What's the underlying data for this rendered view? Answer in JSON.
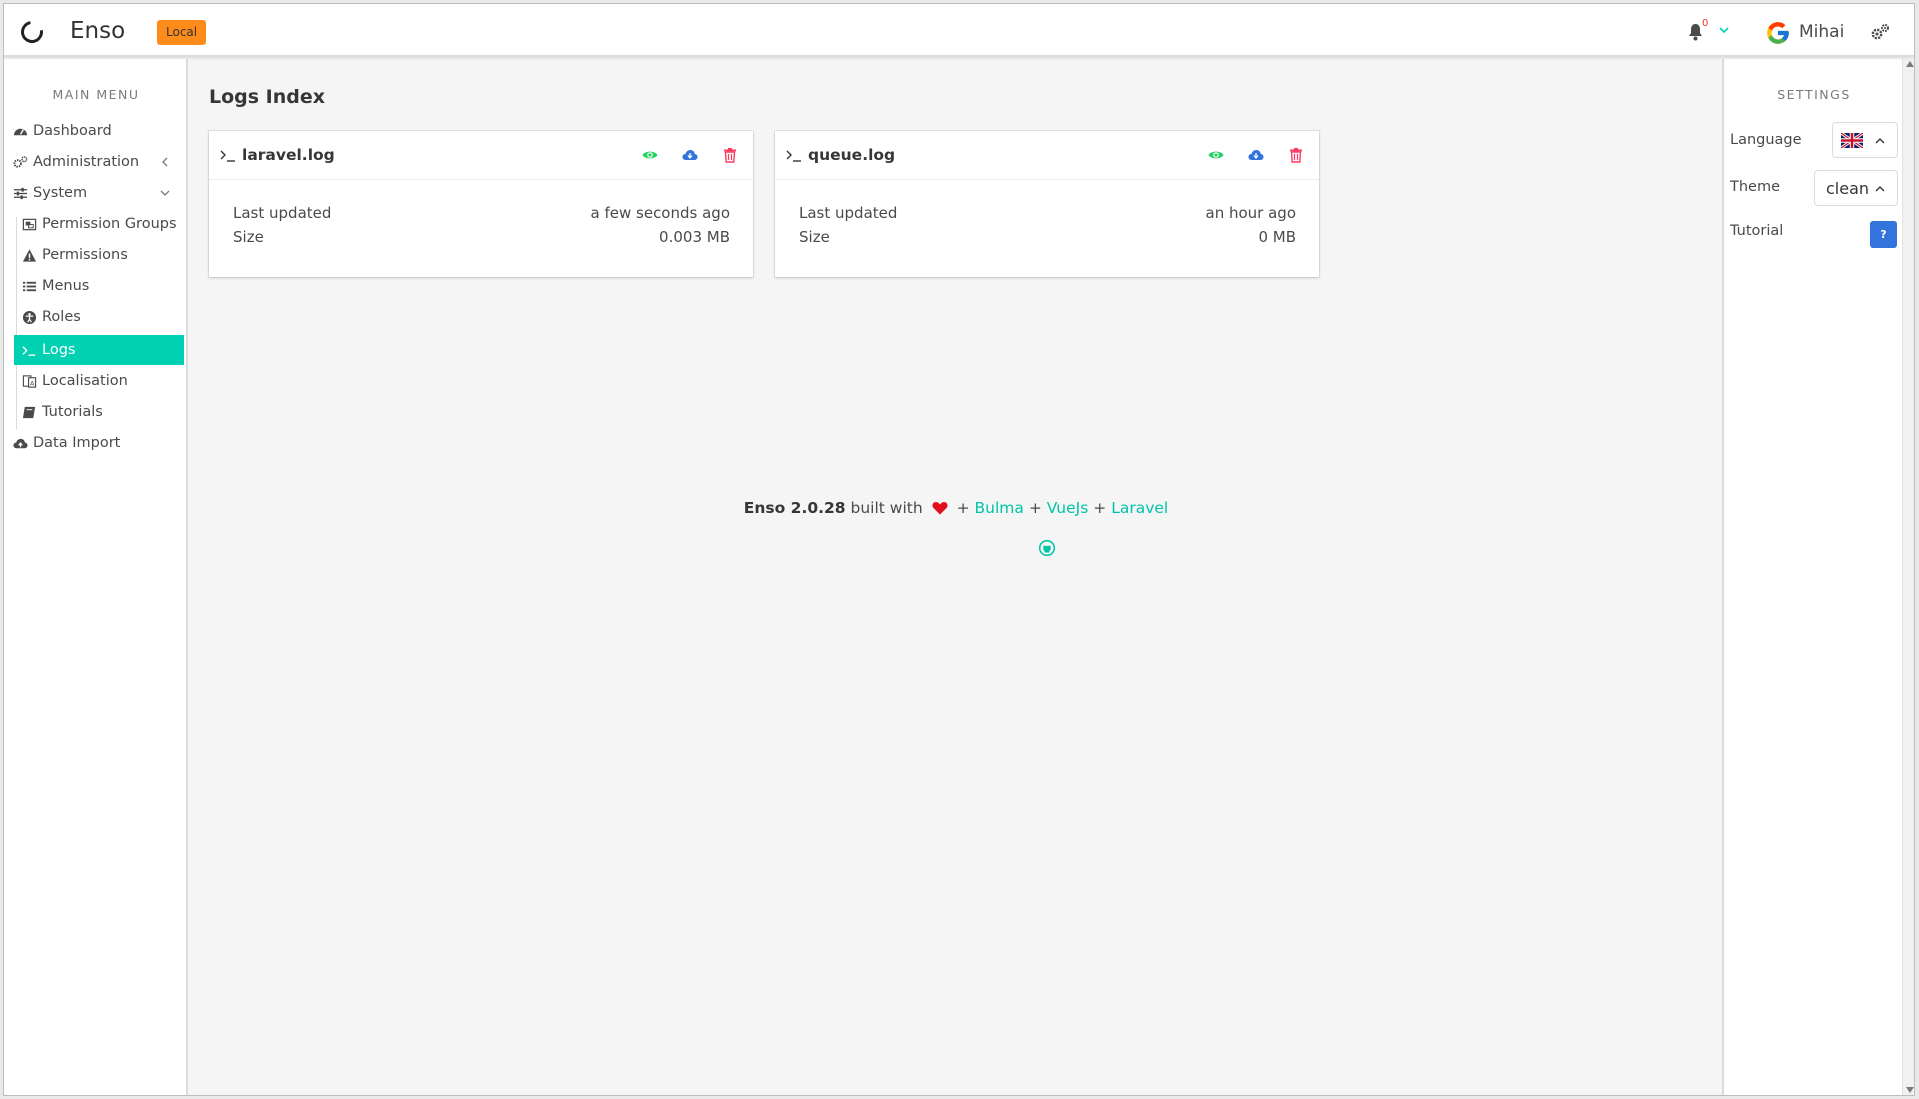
{
  "navbar": {
    "brand": "Enso",
    "env_badge": "Local",
    "notification_count": "0",
    "user_name": "Mihai"
  },
  "sidebar": {
    "title": "Main Menu",
    "items": [
      {
        "label": "Dashboard",
        "icon": "tachometer-icon"
      },
      {
        "label": "Administration",
        "icon": "users-cog-icon"
      },
      {
        "label": "System",
        "icon": "sliders-icon"
      },
      {
        "label": "Permission Groups",
        "icon": "object-group-icon"
      },
      {
        "label": "Permissions",
        "icon": "exclamation-triangle-icon"
      },
      {
        "label": "Menus",
        "icon": "list-icon"
      },
      {
        "label": "Roles",
        "icon": "universal-access-icon"
      },
      {
        "label": "Logs",
        "icon": "terminal-icon"
      },
      {
        "label": "Localisation",
        "icon": "language-icon"
      },
      {
        "label": "Tutorials",
        "icon": "book-icon"
      },
      {
        "label": "Data Import",
        "icon": "cloud-upload-icon"
      }
    ],
    "active": "Logs"
  },
  "main": {
    "title": "Logs Index",
    "logs": [
      {
        "name": "laravel.log",
        "last_updated_label": "Last updated",
        "last_updated": "a few seconds ago",
        "size_label": "Size",
        "size": "0.003 MB"
      },
      {
        "name": "queue.log",
        "last_updated_label": "Last updated",
        "last_updated": "an hour ago",
        "size_label": "Size",
        "size": "0 MB"
      }
    ],
    "footer": {
      "product": "Enso 2.0.28",
      "built_with": "built with",
      "plus": "+",
      "link1": "Bulma",
      "link2": "VueJs",
      "link3": "Laravel"
    }
  },
  "settings": {
    "title": "Settings",
    "language_label": "Language",
    "theme_label": "Theme",
    "theme_value": "clean",
    "tutorial_label": "Tutorial",
    "tutorial_button": "?"
  },
  "colors": {
    "accent": "#00d1b2",
    "badge": "#ff8c1a",
    "view": "#23d160",
    "download": "#3273dc",
    "delete": "#ff3860",
    "link": "#00c4a7"
  }
}
